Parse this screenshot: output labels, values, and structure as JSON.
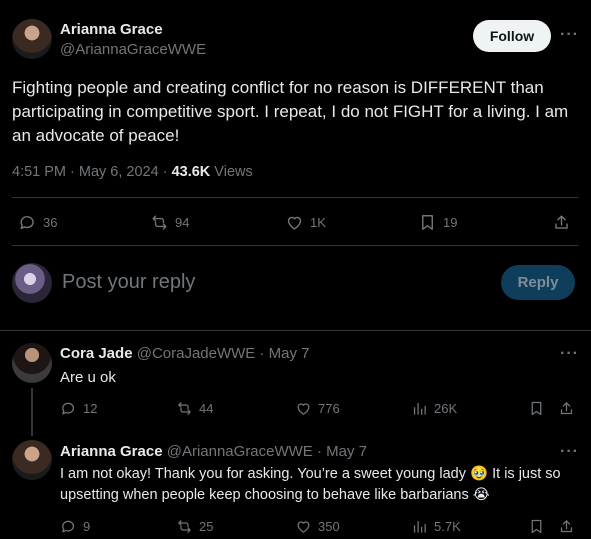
{
  "main_tweet": {
    "author_name": "Arianna Grace",
    "author_handle": "@AriannaGraceWWE",
    "follow_label": "Follow",
    "text": "Fighting people and creating conflict for no reason is DIFFERENT than participating in competitive sport. I repeat, I do not FIGHT for a living. I am an advocate of peace!",
    "time": "4:51 PM · May 6, 2024 · ",
    "views_count": "43.6K",
    "views_label": " Views",
    "replies": "36",
    "reposts": "94",
    "likes": "1K",
    "bookmarks": "19"
  },
  "reply_box": {
    "placeholder": "Post your reply",
    "button_label": "Reply"
  },
  "replies": [
    {
      "author_name": "Cora Jade",
      "author_handle": "@CoraJadeWWE",
      "date": " · May 7",
      "text": "Are u ok",
      "replies": "12",
      "reposts": "44",
      "likes": "776",
      "views": "26K"
    },
    {
      "author_name": "Arianna Grace",
      "author_handle": "@AriannaGraceWWE",
      "date": " · May 7",
      "text_part1": "I am not okay! Thank you for asking. You’re a sweet young lady ",
      "emoji1": "🥹",
      "text_part2": " It is just so upsetting when people keep choosing to behave like barbarians ",
      "emoji2": "😭",
      "replies": "9",
      "reposts": "25",
      "likes": "350",
      "views": "5.7K"
    }
  ],
  "colors": {
    "background": "#000000",
    "text": "#e7e9ea",
    "muted": "#71767b",
    "divider": "#2f3336",
    "reply_button_bg": "#0f3e5c"
  }
}
